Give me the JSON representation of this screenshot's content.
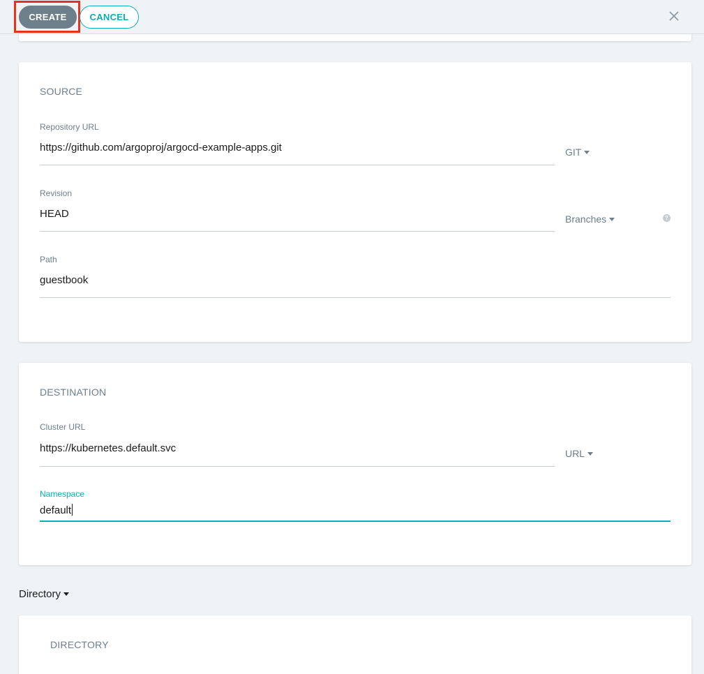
{
  "toolbar": {
    "create_label": "CREATE",
    "cancel_label": "CANCEL"
  },
  "source": {
    "title": "SOURCE",
    "repo_url": {
      "label": "Repository URL",
      "value": "https://github.com/argoproj/argocd-example-apps.git",
      "type": "GIT"
    },
    "revision": {
      "label": "Revision",
      "value": "HEAD",
      "type": "Branches"
    },
    "path": {
      "label": "Path",
      "value": "guestbook"
    }
  },
  "destination": {
    "title": "DESTINATION",
    "cluster_url": {
      "label": "Cluster URL",
      "value": "https://kubernetes.default.svc",
      "type": "URL"
    },
    "namespace": {
      "label": "Namespace",
      "value": "default"
    }
  },
  "directory": {
    "selector": "Directory",
    "title": "DIRECTORY"
  },
  "colors": {
    "accent": "#0dadb5",
    "create_button": "#6d7f8b",
    "highlight": "#e5321c",
    "background": "#eff3f6"
  }
}
